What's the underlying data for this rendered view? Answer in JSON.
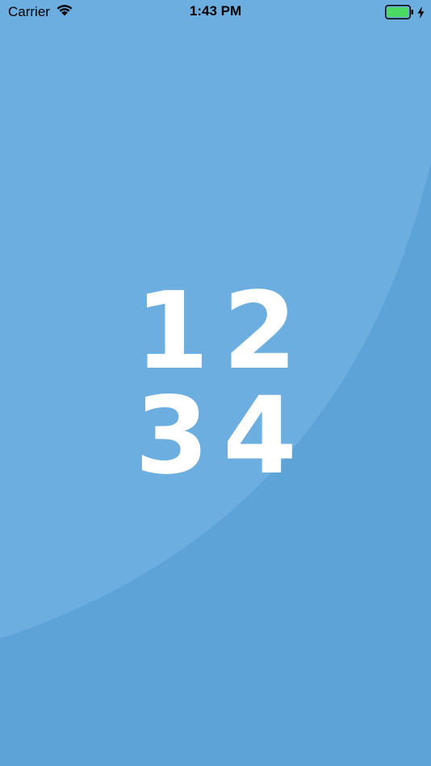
{
  "status_bar": {
    "carrier": "Carrier",
    "time": "1:43 PM",
    "icons": {
      "wifi": "wifi-icon",
      "battery": "battery-icon",
      "charging": "charging-bolt-icon"
    },
    "battery_color": "#4cd964"
  },
  "splash": {
    "digits": [
      "1",
      "2",
      "3",
      "4"
    ]
  },
  "colors": {
    "background": "#5da3d8",
    "background_highlight": "#6caee0",
    "digit": "#ffffff"
  }
}
